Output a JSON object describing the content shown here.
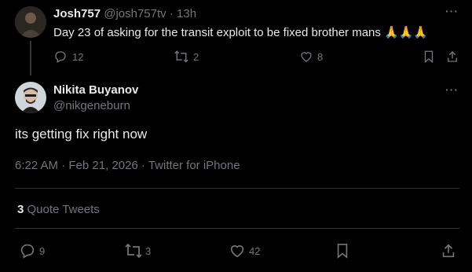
{
  "parent_tweet": {
    "display_name": "Josh757",
    "handle": "@josh757tv",
    "separator": "·",
    "time_ago": "13h",
    "text": "Day 23 of asking for the transit exploit to be fixed brother mans",
    "emoji": "🙏🙏🙏",
    "replies": "12",
    "retweets": "2",
    "likes": "8"
  },
  "main_tweet": {
    "display_name": "Nikita Buyanov",
    "handle": "@nikgeneburn",
    "text": "its getting fix right now",
    "timestamp": "6:22 AM · Feb 21, 2026 · Twitter for iPhone",
    "quote_count": "3",
    "quote_label": "Quote Tweets",
    "replies": "9",
    "retweets": "3",
    "likes": "42"
  },
  "colors": {
    "background": "#000000",
    "text": "#e7e9ea",
    "muted": "#71767b",
    "divider": "#2f3336"
  }
}
